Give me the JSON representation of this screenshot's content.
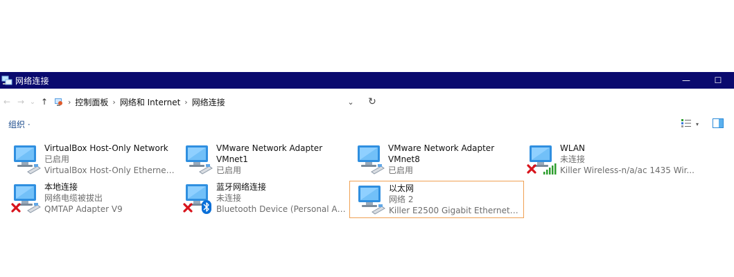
{
  "window": {
    "title": "网络连接",
    "minimize_glyph": "—",
    "maximize_glyph": "☐"
  },
  "address": {
    "back_glyph": "←",
    "forward_glyph": "→",
    "recent_glyph": "⌄",
    "up_glyph": "↑",
    "breadcrumbs": [
      "控制面板",
      "网络和 Internet",
      "网络连接"
    ],
    "separator": "›",
    "dropdown_glyph": "⌄",
    "refresh_glyph": "↻"
  },
  "commandbar": {
    "organize_label": "组织 ·",
    "view_dropdown_glyph": "▾"
  },
  "connections": [
    {
      "name": "VirtualBox Host-Only Network",
      "status": "已启用",
      "device": "VirtualBox Host-Only Ethernet ...",
      "badge": "none",
      "selected": false
    },
    {
      "name": "VMware Network Adapter VMnet1",
      "status": "已启用",
      "device": "",
      "badge": "none",
      "selected": false
    },
    {
      "name": "VMware Network Adapter VMnet8",
      "status": "已启用",
      "device": "",
      "badge": "none",
      "selected": false
    },
    {
      "name": "WLAN",
      "status": "未连接",
      "device": "Killer Wireless-n/a/ac 1435 Wir...",
      "badge": "wireless-x",
      "selected": false
    },
    {
      "name": "本地连接",
      "status": "网络电缆被拔出",
      "device": "QMTAP Adapter V9",
      "badge": "x",
      "selected": false
    },
    {
      "name": "蓝牙网络连接",
      "status": "未连接",
      "device": "Bluetooth Device (Personal Are...",
      "badge": "bluetooth-x",
      "selected": false
    },
    {
      "name": "以太网",
      "status": "网络 2",
      "device": "Killer E2500 Gigabit Ethernet C...",
      "badge": "none",
      "selected": true
    }
  ],
  "vmnet_names": {
    "vmnet1_line1": "VMware Network Adapter",
    "vmnet1_line2": "VMnet1",
    "vmnet8_line1": "VMware Network Adapter",
    "vmnet8_line2": "VMnet8"
  },
  "colors": {
    "titlebar": "#0a0a6e",
    "accent_link": "#1a4a8c",
    "selection_border": "#f0a052",
    "error_red": "#d8141c",
    "bluetooth_blue": "#0a6fd8",
    "signal_green": "#2e9e2e"
  }
}
